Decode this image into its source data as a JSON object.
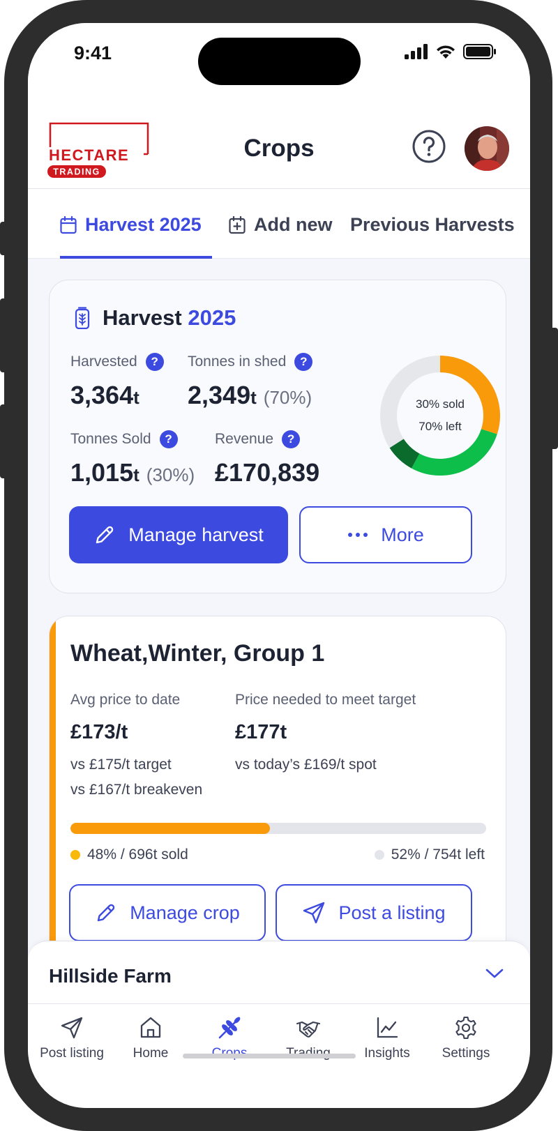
{
  "status": {
    "time": "9:41"
  },
  "header": {
    "logo_top": "HECTARE",
    "logo_bottom": "TRADING",
    "title": "Crops"
  },
  "tabs": [
    {
      "label": "Harvest 2025",
      "icon": "calendar-icon"
    },
    {
      "label": "Add new",
      "icon": "calendar-add-icon"
    },
    {
      "label": "Previous Harvests",
      "icon": null
    }
  ],
  "summary": {
    "title_prefix": "Harvest",
    "title_year": "2025",
    "harvested_label": "Harvested",
    "harvested_value": "3,364",
    "harvested_unit": "t",
    "shed_label": "Tonnes in shed",
    "shed_value": "2,349",
    "shed_unit": "t",
    "shed_pct": "(70%)",
    "sold_label": "Tonnes Sold",
    "sold_value": "1,015",
    "sold_unit": "t",
    "sold_pct": "(30%)",
    "revenue_label": "Revenue",
    "revenue_value": "£170,839",
    "donut_sold": "30% sold",
    "donut_left": "70% left",
    "sold_fraction": 0.3,
    "manage_button": "Manage harvest",
    "more_button": "More"
  },
  "crop": {
    "title": "Wheat,Winter, Group 1",
    "avg_label": "Avg price to date",
    "avg_value": "£173/t",
    "avg_sub1": "vs £175/t target",
    "avg_sub2": "vs £167/t breakeven",
    "needed_label": "Price needed to meet target",
    "needed_value": "£177t",
    "needed_sub": "vs today’s £169/t spot",
    "sold_fraction": 0.48,
    "sold_text": "48% / 696t sold",
    "left_text": "52% / 754t left",
    "manage_button": "Manage crop",
    "post_button": "Post a listing"
  },
  "farm": {
    "name": "Hillside Farm"
  },
  "nav": [
    {
      "label": "Post listing",
      "icon": "send-icon"
    },
    {
      "label": "Home",
      "icon": "home-icon"
    },
    {
      "label": "Crops",
      "icon": "wheat-icon"
    },
    {
      "label": "Trading",
      "icon": "handshake-icon"
    },
    {
      "label": "Insights",
      "icon": "chart-icon"
    },
    {
      "label": "Settings",
      "icon": "gear-icon"
    }
  ],
  "colors": {
    "accent": "#3d4ae0",
    "crop_stripe": "#f99a0a",
    "donut_orange": "#f99a0a",
    "donut_green": "#0dbf4a",
    "donut_dark_green": "#0a6b2c",
    "logo_red": "#d0181f"
  }
}
